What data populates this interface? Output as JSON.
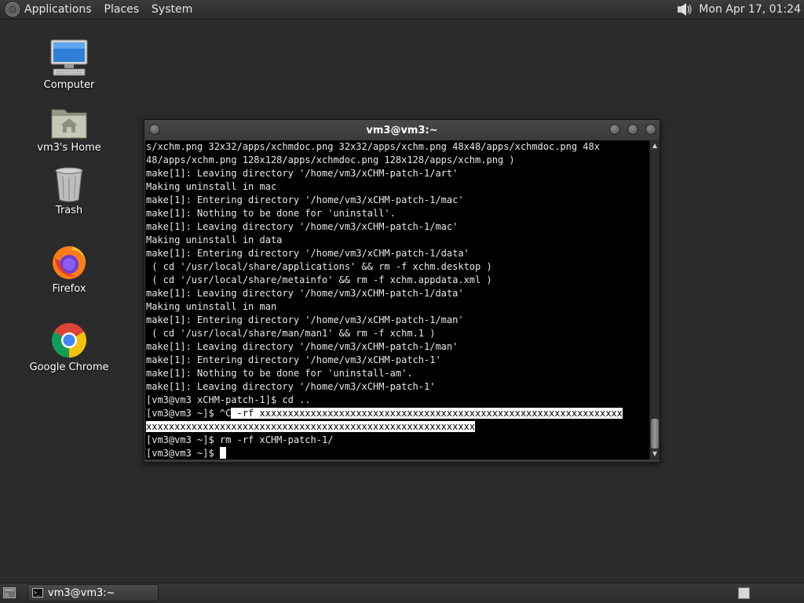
{
  "top_panel": {
    "menus": [
      "Applications",
      "Places",
      "System"
    ],
    "clock": "Mon Apr 17, 01:24"
  },
  "desktop_icons": [
    {
      "label": "Computer",
      "icon": "computer-icon"
    },
    {
      "label": "vm3's Home",
      "icon": "home-folder-icon"
    },
    {
      "label": "Trash",
      "icon": "trash-icon"
    },
    {
      "label": "Firefox",
      "icon": "firefox-icon"
    },
    {
      "label": "Google Chrome",
      "icon": "chrome-icon"
    }
  ],
  "terminal": {
    "title": "vm3@vm3:~",
    "lines": [
      "s/xchm.png 32x32/apps/xchmdoc.png 32x32/apps/xchm.png 48x48/apps/xchmdoc.png 48x",
      "48/apps/xchm.png 128x128/apps/xchmdoc.png 128x128/apps/xchm.png )",
      "make[1]: Leaving directory '/home/vm3/xCHM-patch-1/art'",
      "Making uninstall in mac",
      "make[1]: Entering directory '/home/vm3/xCHM-patch-1/mac'",
      "make[1]: Nothing to be done for 'uninstall'.",
      "make[1]: Leaving directory '/home/vm3/xCHM-patch-1/mac'",
      "Making uninstall in data",
      "make[1]: Entering directory '/home/vm3/xCHM-patch-1/data'",
      " ( cd '/usr/local/share/applications' && rm -f xchm.desktop )",
      " ( cd '/usr/local/share/metainfo' && rm -f xchm.appdata.xml )",
      "make[1]: Leaving directory '/home/vm3/xCHM-patch-1/data'",
      "Making uninstall in man",
      "make[1]: Entering directory '/home/vm3/xCHM-patch-1/man'",
      " ( cd '/usr/local/share/man/man1' && rm -f xchm.1 )",
      "make[1]: Leaving directory '/home/vm3/xCHM-patch-1/man'",
      "make[1]: Entering directory '/home/vm3/xCHM-patch-1'",
      "make[1]: Nothing to be done for 'uninstall-am'.",
      "make[1]: Leaving directory '/home/vm3/xCHM-patch-1'",
      "[vm3@vm3 xCHM-patch-1]$ cd .."
    ],
    "sel_line1_prefix": "[vm3@vm3 ~]$ ^C",
    "sel_line1_selected": " -rf xxxxxxxxxxxxxxxxxxxxxxxxxxxxxxxxxxxxxxxxxxxxxxxxxxxxxxxxxxxxxxxx",
    "sel_line2_selected": "xxxxxxxxxxxxxxxxxxxxxxxxxxxxxxxxxxxxxxxxxxxxxxxxxxxxxxxxxx",
    "rm_line": "[vm3@vm3 ~]$ rm -rf xCHM-patch-1/",
    "prompt": "[vm3@vm3 ~]$ "
  },
  "bottom_panel": {
    "taskbar_label": "vm3@vm3:~"
  }
}
